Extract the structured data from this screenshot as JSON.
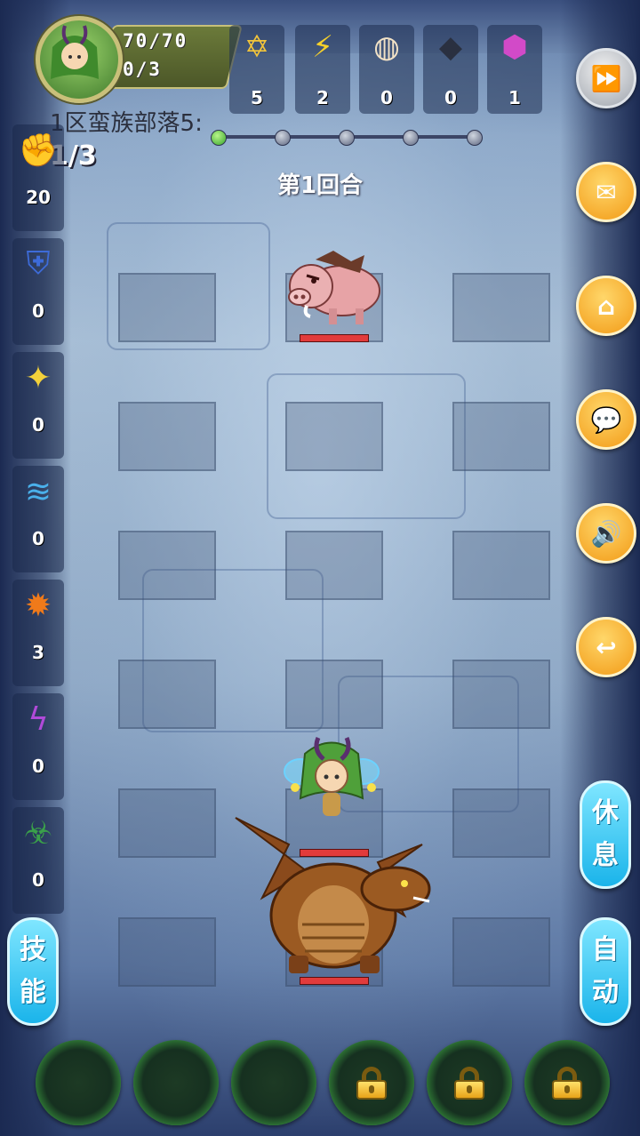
{
  "player": {
    "hp": "70/70",
    "sub": "0/3"
  },
  "resources": [
    {
      "icon": "gold-coin-icon",
      "glyph": "✡",
      "value": "5"
    },
    {
      "icon": "lightning-icon",
      "glyph": "⚡",
      "value": "2"
    },
    {
      "icon": "bun-icon",
      "glyph": "◍",
      "value": "0"
    },
    {
      "icon": "ore-icon",
      "glyph": "◆",
      "value": "0"
    },
    {
      "icon": "crystal-icon",
      "glyph": "⬢",
      "value": "1"
    }
  ],
  "stage": {
    "name": "1区蛮族部落5:",
    "count": "1/3",
    "round": "第1回合",
    "progress_done": 1,
    "progress_total": 5
  },
  "left_items": [
    {
      "icon": "fist-icon",
      "glyph": "✊",
      "value": "20",
      "color": "#b8743a"
    },
    {
      "icon": "shield-icon",
      "glyph": "⛨",
      "value": "0",
      "color": "#3d6bd8"
    },
    {
      "icon": "holy-light-icon",
      "glyph": "✦",
      "value": "0",
      "color": "#f3d13a"
    },
    {
      "icon": "water-wave-icon",
      "glyph": "≋",
      "value": "0",
      "color": "#4ab0ea"
    },
    {
      "icon": "fireball-icon",
      "glyph": "✹",
      "value": "3",
      "color": "#f07a1a"
    },
    {
      "icon": "lightning-rune-icon",
      "glyph": "ϟ",
      "value": "0",
      "color": "#b04ad8"
    },
    {
      "icon": "poison-icon",
      "glyph": "☣",
      "value": "0",
      "color": "#3aa04a"
    }
  ],
  "right_buttons": [
    {
      "name": "fast-forward-button",
      "glyph": "⏩"
    },
    {
      "name": "mail-button",
      "glyph": "✉"
    },
    {
      "name": "home-button",
      "glyph": "⌂"
    },
    {
      "name": "chat-button",
      "glyph": "💬"
    },
    {
      "name": "sound-button",
      "glyph": "🔊"
    },
    {
      "name": "return-button",
      "glyph": "↩"
    }
  ],
  "pills": {
    "rest": "休\n息",
    "auto": "自\n动",
    "skill": "技\n能"
  },
  "bottom_slots": [
    {
      "locked": false
    },
    {
      "locked": false
    },
    {
      "locked": false
    },
    {
      "locked": true
    },
    {
      "locked": true
    },
    {
      "locked": true
    }
  ],
  "colors": {
    "accent_orange": "#f29a16",
    "accent_cyan": "#1ab4ea",
    "hp_red": "#e23b3b"
  }
}
